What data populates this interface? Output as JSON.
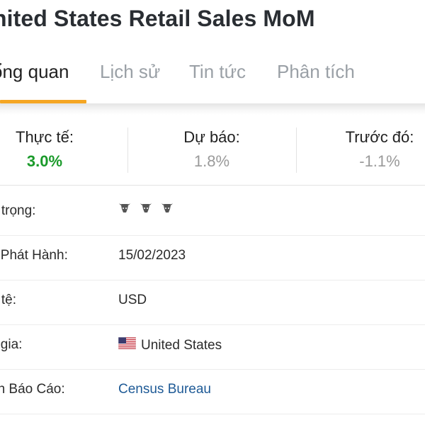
{
  "header": {
    "title": "nited States Retail Sales MoM"
  },
  "tabs": [
    {
      "label": "ổng quan",
      "active": true
    },
    {
      "label": "Lịch sử",
      "active": false
    },
    {
      "label": "Tin tức",
      "active": false
    },
    {
      "label": "Phân tích",
      "active": false
    }
  ],
  "stats": {
    "actual": {
      "label": "Thực tế:",
      "value": "3.0%"
    },
    "forecast": {
      "label": "Dự báo:",
      "value": "1.8%"
    },
    "previous": {
      "label": "Trước đó:",
      "value": "-1.1%"
    }
  },
  "details": {
    "importance": {
      "label": "n trọng:",
      "icon": "bull-icon",
      "level": 3,
      "max": 3
    },
    "release_date": {
      "label": "y Phát Hành:",
      "value": "15/02/2023"
    },
    "currency": {
      "label": "n tệ:",
      "value": "USD"
    },
    "country": {
      "label": "c gia:",
      "value": "United States",
      "flag": "us-flag-icon"
    },
    "source": {
      "label": "ồn Báo Cáo:",
      "value": "Census Bureau"
    }
  },
  "colors": {
    "accent": "#f5a623",
    "positive": "#1a9a2a",
    "muted": "#9a9a9a",
    "link": "#1e5a96"
  }
}
